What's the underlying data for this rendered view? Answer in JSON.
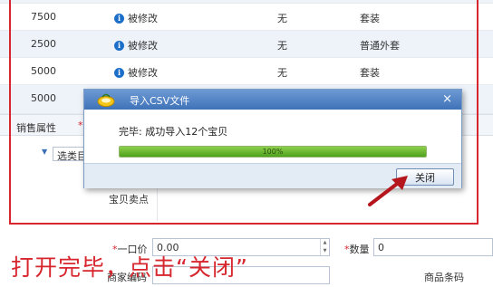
{
  "table": {
    "rows": [
      {
        "num": "7500",
        "status": "被修改",
        "inventory": "无",
        "category": "套装"
      },
      {
        "num": "2500",
        "status": "被修改",
        "inventory": "无",
        "category": "普通外套"
      },
      {
        "num": "5000",
        "status": "被修改",
        "inventory": "无",
        "category": "套装"
      },
      {
        "num": "5000",
        "status": "",
        "inventory": "",
        "category": ""
      }
    ]
  },
  "form": {
    "sales_attr_label": "销售属性",
    "required_mark": "*",
    "category_select": "选类目",
    "selling_point_label": "宝贝卖点",
    "price_label": "一口价",
    "price_value": "0.00",
    "quantity_label": "数量",
    "quantity_value": "0",
    "merchant_code_label": "商家编码",
    "barcode_label": "商品条码"
  },
  "dialog": {
    "title": "导入CSV文件",
    "close_glyph": "×",
    "message": "完毕: 成功导入12个宝贝",
    "progress": 1.0,
    "progress_text": "100%",
    "button": "关闭"
  },
  "caption": "打开完毕，点击“关闭”",
  "colors": {
    "highlight": "#d7262d",
    "title_bar": "#3f72b8",
    "progress": "#4da11e"
  }
}
